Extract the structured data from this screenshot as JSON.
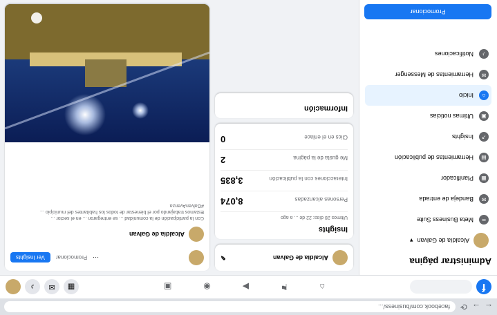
{
  "browser": {
    "url": "facebook.com/business/..."
  },
  "fb": {
    "logo": "f"
  },
  "sidebar": {
    "title": "Administrar página",
    "page_name": "Alcaldía de Galvan",
    "items": [
      {
        "label": "Meta Business Suite"
      },
      {
        "label": "Bandeja de entrada"
      },
      {
        "label": "Planificador"
      },
      {
        "label": "Herramientas de publicación"
      },
      {
        "label": "Insights"
      },
      {
        "label": "Ultimas noticias"
      },
      {
        "label": "Inicio"
      },
      {
        "label": "Herramientas de Messenger"
      },
      {
        "label": "Notificaciones"
      }
    ],
    "promo_button": "Promocionar"
  },
  "middle": {
    "page_name": "Alcaldía de Galvan",
    "insights_title": "Insights",
    "insights_sub": "Ultimos 28 días: 22 de ... a ago",
    "stats": [
      {
        "label": "Personas alcanzadas",
        "value": "8,074"
      },
      {
        "label": "Interacciones con la publicación",
        "value": "3,835"
      },
      {
        "label": "Me gusta de la página",
        "value": "2"
      },
      {
        "label": "Clics en el enlace",
        "value": "0"
      }
    ],
    "info_title": "Información"
  },
  "post": {
    "author": "Alcaldía de Galvan",
    "boost_button": "Promocionar",
    "action_label": "Ver Insights",
    "text1": "Con la participación de la comunidad ... se entregaron ... en el sector ...",
    "text2": "Estamos trabajando por el bienestar de todos los habitantes del municipio ...",
    "text3": "#GalvanAvanza"
  }
}
